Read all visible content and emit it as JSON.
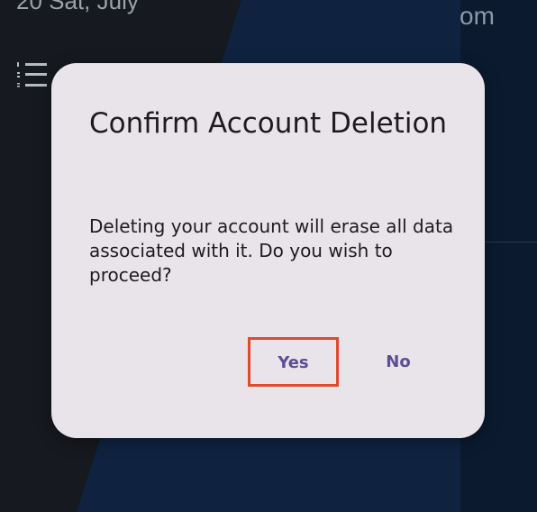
{
  "background": {
    "top_left_text": "20  Sat, July",
    "top_right_text": "om",
    "list_icon": "numbered-list-icon"
  },
  "dialog": {
    "title": "Confirm Account Deletion",
    "body": "Deleting your account will erase all data associated with it. Do you wish to proceed?",
    "confirm_label": "Yes",
    "cancel_label": "No",
    "colors": {
      "surface": "#e9e4ea",
      "accent": "#5b4e92",
      "highlight": "#e04a30"
    }
  }
}
